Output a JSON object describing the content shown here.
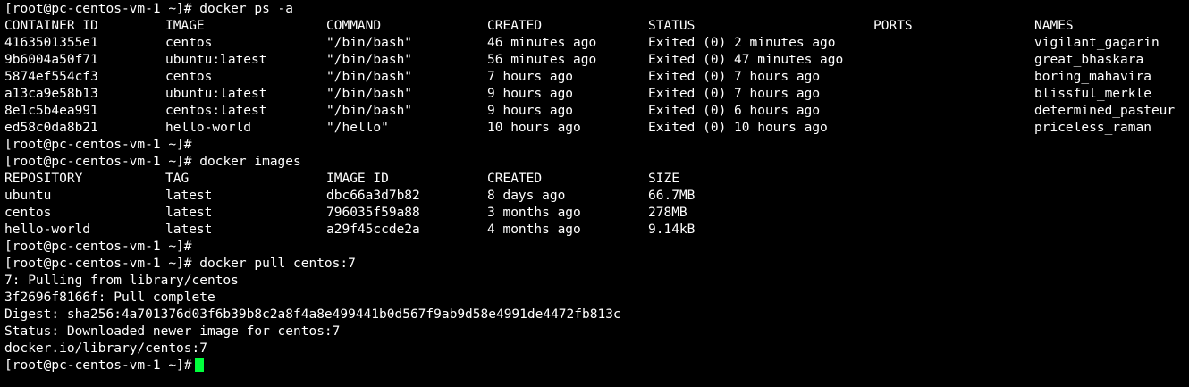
{
  "prompt": "[root@pc-centos-vm-1 ~]#",
  "cmd_ps": "docker ps -a",
  "ps_headers": {
    "container_id": "CONTAINER ID",
    "image": "IMAGE",
    "command": "COMMAND",
    "created": "CREATED",
    "status": "STATUS",
    "ports": "PORTS",
    "names": "NAMES"
  },
  "ps_rows": [
    {
      "container_id": "4163501355e1",
      "image": "centos",
      "command": "\"/bin/bash\"",
      "created": "46 minutes ago",
      "status": "Exited (0) 2 minutes ago",
      "ports": "",
      "names": "vigilant_gagarin"
    },
    {
      "container_id": "9b6004a50f71",
      "image": "ubuntu:latest",
      "command": "\"/bin/bash\"",
      "created": "56 minutes ago",
      "status": "Exited (0) 47 minutes ago",
      "ports": "",
      "names": "great_bhaskara"
    },
    {
      "container_id": "5874ef554cf3",
      "image": "centos",
      "command": "\"/bin/bash\"",
      "created": "7 hours ago",
      "status": "Exited (0) 7 hours ago",
      "ports": "",
      "names": "boring_mahavira"
    },
    {
      "container_id": "a13ca9e58b13",
      "image": "ubuntu:latest",
      "command": "\"/bin/bash\"",
      "created": "9 hours ago",
      "status": "Exited (0) 7 hours ago",
      "ports": "",
      "names": "blissful_merkle"
    },
    {
      "container_id": "8e1c5b4ea991",
      "image": "centos:latest",
      "command": "\"/bin/bash\"",
      "created": "9 hours ago",
      "status": "Exited (0) 6 hours ago",
      "ports": "",
      "names": "determined_pasteur"
    },
    {
      "container_id": "ed58c0da8b21",
      "image": "hello-world",
      "command": "\"/hello\"",
      "created": "10 hours ago",
      "status": "Exited (0) 10 hours ago",
      "ports": "",
      "names": "priceless_raman"
    }
  ],
  "cmd_images": "docker images",
  "images_headers": {
    "repository": "REPOSITORY",
    "tag": "TAG",
    "image_id": "IMAGE ID",
    "created": "CREATED",
    "size": "SIZE"
  },
  "images_rows": [
    {
      "repository": "ubuntu",
      "tag": "latest",
      "image_id": "dbc66a3d7b82",
      "created": "8 days ago",
      "size": "66.7MB"
    },
    {
      "repository": "centos",
      "tag": "latest",
      "image_id": "796035f59a88",
      "created": "3 months ago",
      "size": "278MB"
    },
    {
      "repository": "hello-world",
      "tag": "latest",
      "image_id": "a29f45ccde2a",
      "created": "4 months ago",
      "size": "9.14kB"
    }
  ],
  "cmd_pull": "docker pull centos:7",
  "pull_output": [
    "7: Pulling from library/centos",
    "3f2696f8166f: Pull complete",
    "Digest: sha256:4a701376d03f6b39b8c2a8f4a8e499441b0d567f9ab9d58e4991de4472fb813c",
    "Status: Downloaded newer image for centos:7",
    "docker.io/library/centos:7"
  ],
  "colors": {
    "background": "#000000",
    "foreground": "#ffffff",
    "cursor": "#00ff3c"
  }
}
